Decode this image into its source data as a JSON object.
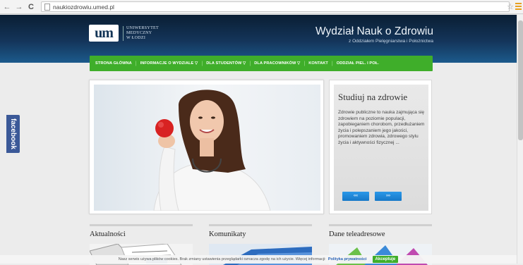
{
  "browser": {
    "back_icon": "arrow-left-icon",
    "forward_icon": "arrow-right-icon",
    "reload_icon": "reload-icon",
    "url": "naukiozdrowiu.umed.pl",
    "star_icon": "star-icon",
    "menu_icon": "hamburger-menu-icon"
  },
  "header": {
    "logo_mark": "um",
    "logo_line1": "UNIWERSYTET",
    "logo_line2": "MEDYCZNY",
    "logo_line3": "W ŁODZI",
    "title": "Wydział Nauk o Zdrowiu",
    "subtitle": "z Oddziałem Pielęgniarstwa i Położnictwa"
  },
  "nav": {
    "items": [
      {
        "label": "STRONA GŁÓWNA"
      },
      {
        "label": "INFORMACJE O WYDZIALE ▽"
      },
      {
        "label": "DLA STUDENTÓW ▽"
      },
      {
        "label": "DLA PRACOWNIKÓW ▽"
      },
      {
        "label": "KONTAKT"
      },
      {
        "label": "ODDZIAŁ PIEL. I POŁ."
      }
    ]
  },
  "social": {
    "facebook_label": "facebook"
  },
  "study": {
    "title": "Studiuj na zdrowie",
    "text": "Zdrowie publiczne to nauka zajmująca się zdrowiem na poziomie populacji, zapobieganiem chorobom, przedłużaniem życia i polepszaniem jego jakości, promowaniem zdrowia, zdrowego stylu życia i aktywności fizycznej ...",
    "prev_label": "‹‹‹",
    "next_label": "›››"
  },
  "sections": [
    {
      "title": "Aktualności"
    },
    {
      "title": "Komunikaty"
    },
    {
      "title": "Dane teleadresowe"
    }
  ],
  "cookie": {
    "text": "Nasz serwis używa plików cookies. Brak zmiany ustawienia przeglądarki oznacza zgodę na ich użycie. Więcej informacji:",
    "policy_link": "Polityka prywatności",
    "accept": "Akceptuje"
  },
  "colors": {
    "nav_green": "#3fae2a",
    "header_dark": "#0a1e33",
    "facebook_blue": "#3b5998",
    "button_blue": "#1678c8"
  }
}
